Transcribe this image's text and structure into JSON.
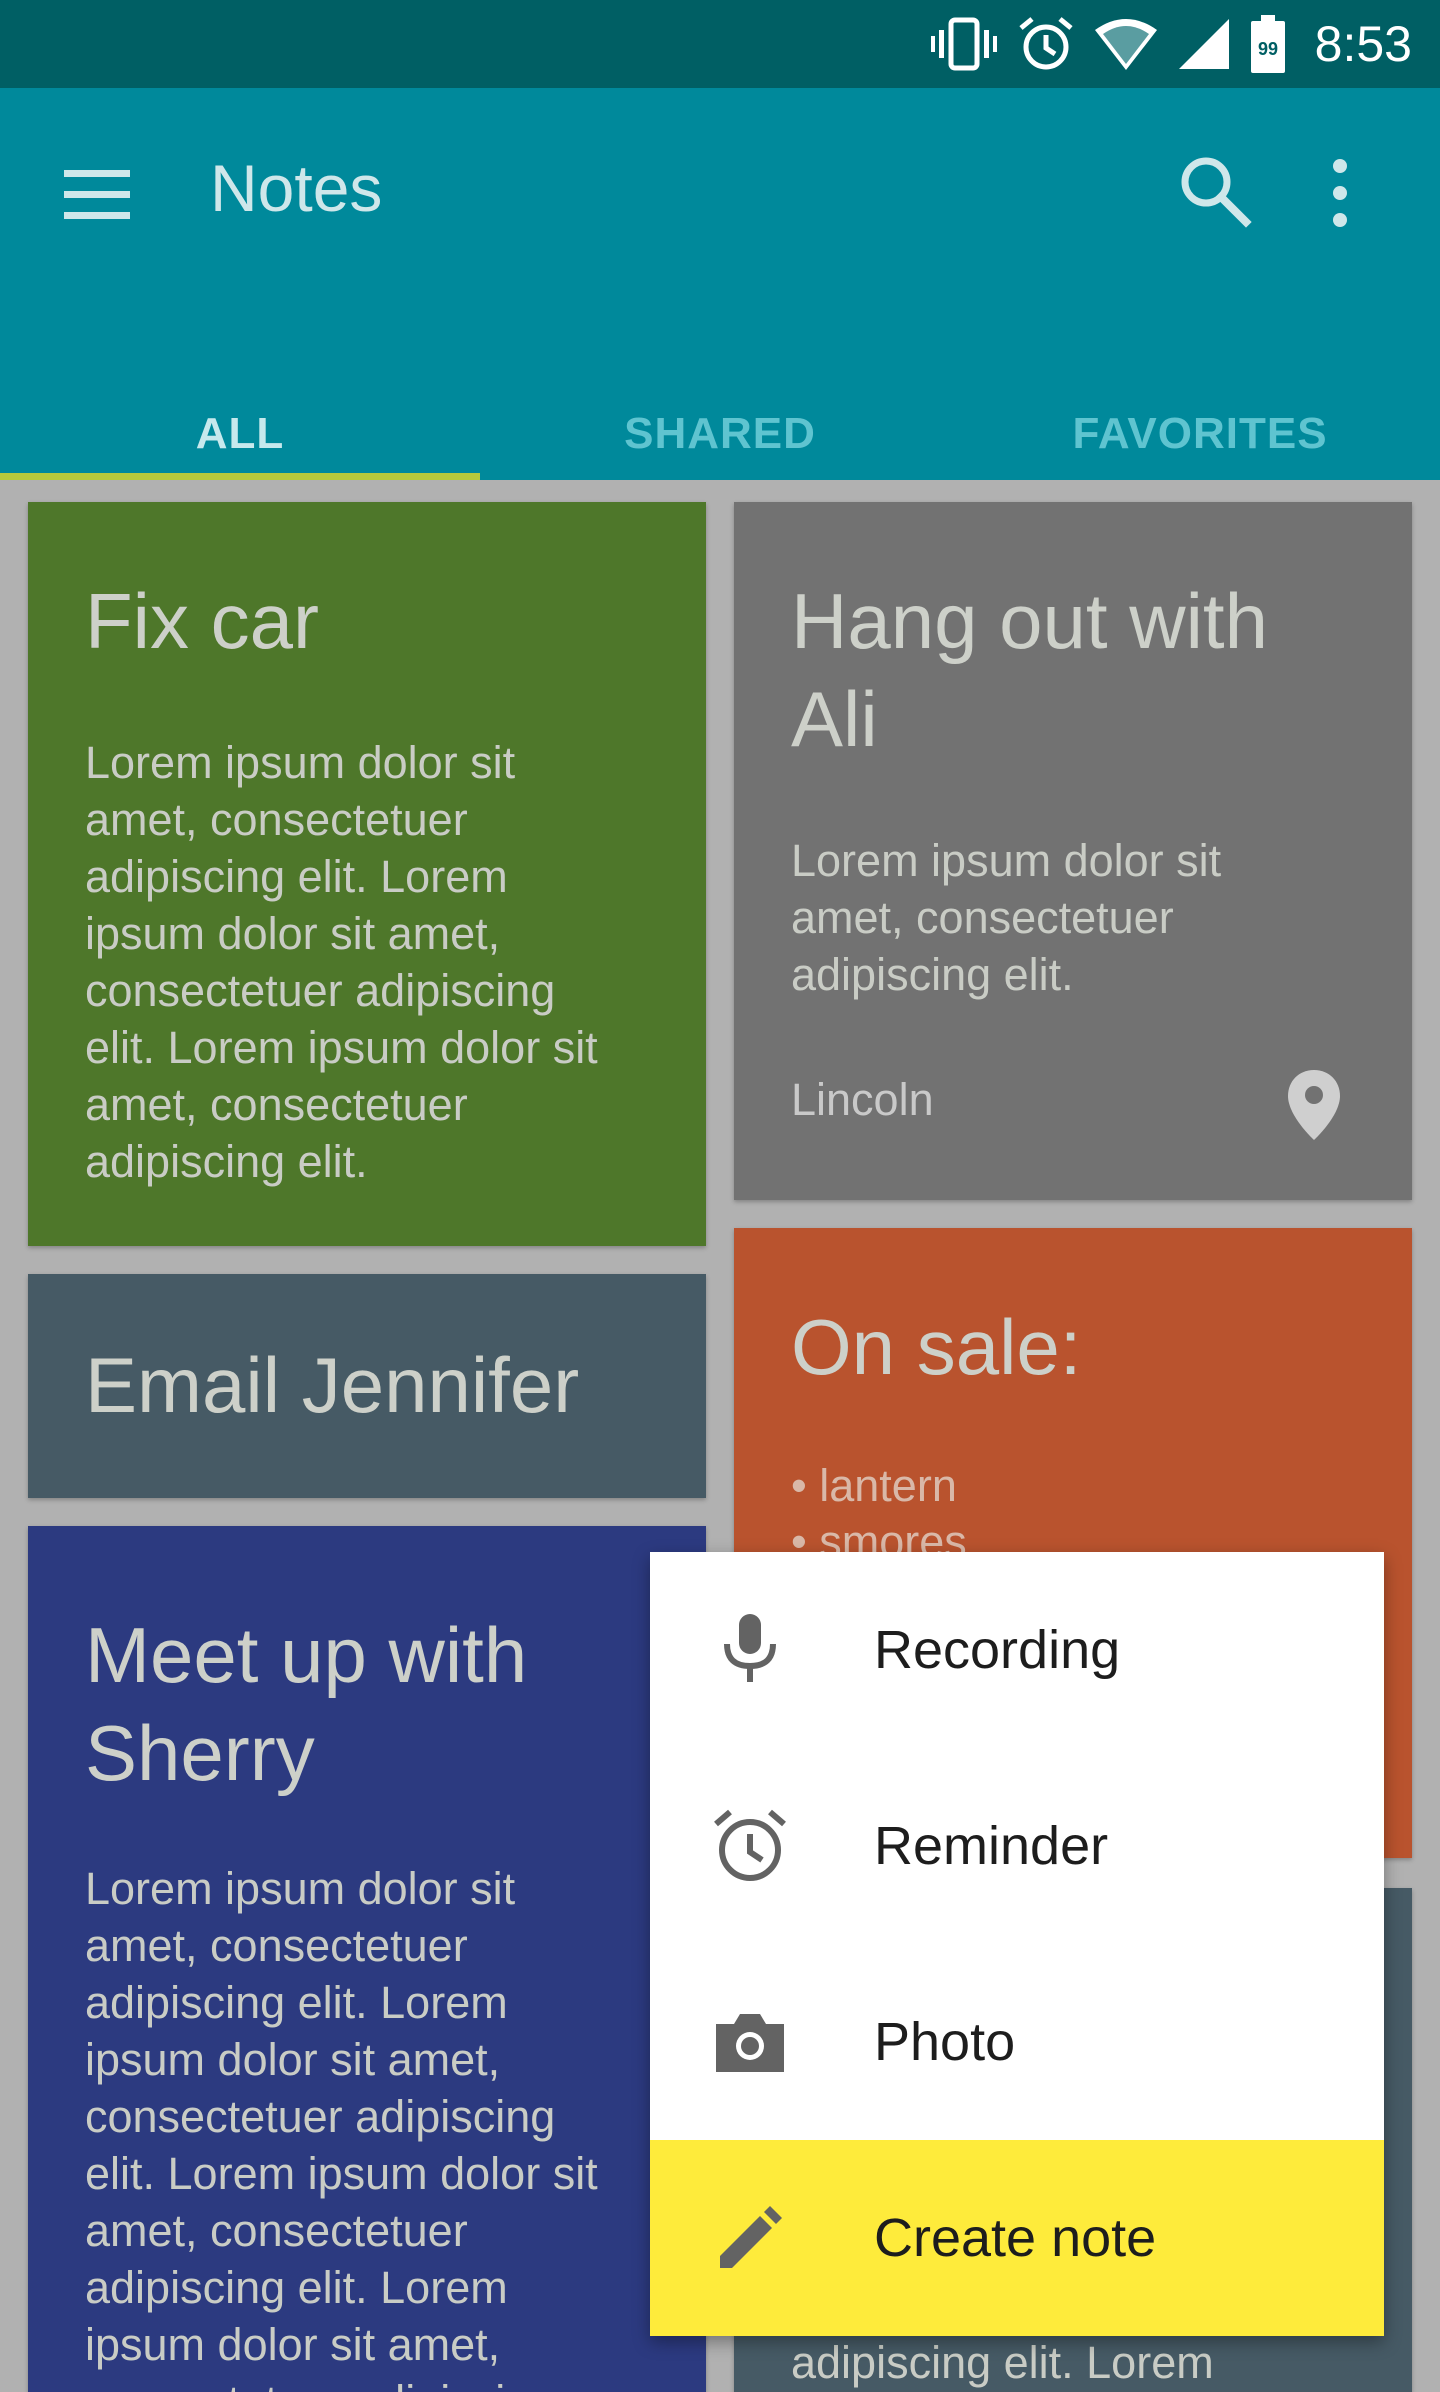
{
  "status_bar": {
    "time": "8:53",
    "battery_level": "99",
    "icons": [
      "vibrate-icon",
      "alarm-icon",
      "wifi-icon",
      "cell-signal-icon",
      "battery-icon"
    ]
  },
  "app_bar": {
    "title": "Notes",
    "menu_icon": "menu-icon",
    "search_icon": "search-icon",
    "more_icon": "more-vert-icon"
  },
  "tabs": [
    {
      "label": "ALL",
      "active": true
    },
    {
      "label": "SHARED",
      "active": false
    },
    {
      "label": "FAVORITES",
      "active": false
    }
  ],
  "notes": {
    "fix_car": {
      "title": "Fix car",
      "body": "Lorem ipsum dolor sit amet, consectetuer adipiscing elit. Lorem ipsum dolor sit amet, consectetuer adipiscing elit. Lorem ipsum dolor sit amet, consectetuer adipiscing elit.",
      "color": "#4e772a"
    },
    "hang_out": {
      "title": "Hang out with Ali",
      "body": "Lorem ipsum dolor sit amet, consectetuer adipiscing elit.",
      "location": "Lincoln",
      "color": "#727272"
    },
    "email": {
      "title": "Email Jennifer",
      "color": "#465a65"
    },
    "on_sale": {
      "title": "On sale:",
      "items": [
        "• lantern",
        "• smores"
      ],
      "color": "#b9532e"
    },
    "sherry": {
      "title": "Meet up with Sherry",
      "body": "Lorem ipsum dolor sit amet, consectetuer adipiscing elit. Lorem ipsum dolor sit amet, consectetuer adipiscing elit. Lorem ipsum dolor sit amet, consectetuer adipiscing elit. Lorem ipsum dolor sit amet, consectetuer adipiscing",
      "color": "#2c3a80"
    },
    "bottom_right": {
      "body": "adipiscing elit. Lorem",
      "color": "#465a65"
    }
  },
  "popup_menu": {
    "items": [
      {
        "label": "Recording",
        "icon": "mic-icon"
      },
      {
        "label": "Reminder",
        "icon": "alarm-icon"
      },
      {
        "label": "Photo",
        "icon": "camera-icon"
      },
      {
        "label": "Create note",
        "icon": "pencil-icon",
        "highlight_color": "#feeb3b"
      }
    ]
  },
  "colors": {
    "status_bar": "#005f64",
    "app_bar": "#00899b",
    "tab_indicator": "#b7c93a",
    "background": "#b1b1b1"
  }
}
